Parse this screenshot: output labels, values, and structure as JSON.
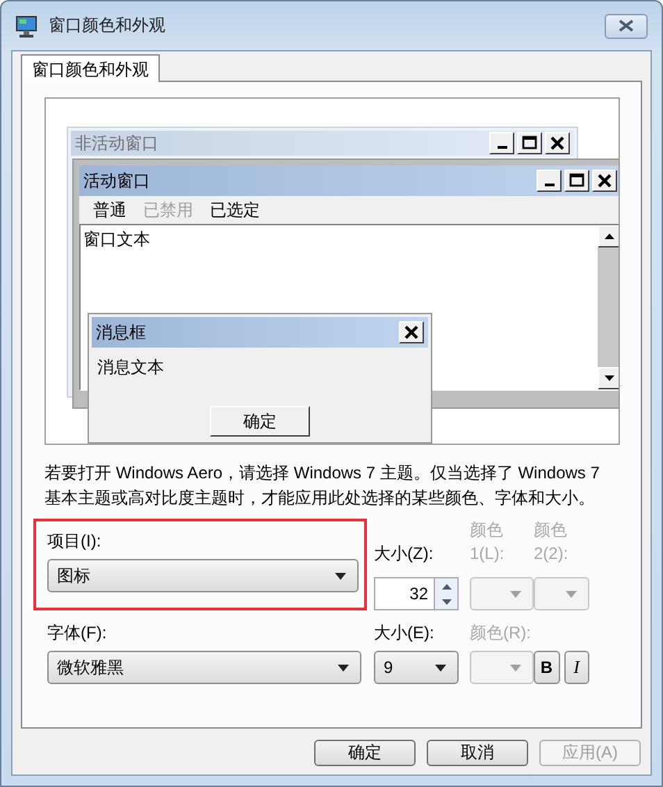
{
  "window": {
    "title": "窗口颜色和外观"
  },
  "tabs": [
    {
      "label": "窗口颜色和外观",
      "selected": true
    }
  ],
  "preview": {
    "inactive_window": {
      "title": "非活动窗口"
    },
    "active_window": {
      "title": "活动窗口",
      "menu": [
        {
          "label": "普通",
          "disabled": false
        },
        {
          "label": "已禁用",
          "disabled": true
        },
        {
          "label": "已选定",
          "disabled": false
        }
      ],
      "text": "窗口文本"
    },
    "message_box": {
      "title": "消息框",
      "text": "消息文本",
      "button": "确定"
    }
  },
  "note": "若要打开 Windows Aero，请选择 Windows 7 主题。仅当选择了 Windows 7 基本主题或高对比度主题时，才能应用此处选择的某些颜色、字体和大小。",
  "item": {
    "label": "项目(I):",
    "value": "图标",
    "highlighted": true
  },
  "item_size": {
    "label": "大小(Z):",
    "value": "32"
  },
  "color_1": {
    "label": "颜色 1(L):",
    "disabled": true
  },
  "color_2": {
    "label": "颜色 2(2):",
    "disabled": true
  },
  "font": {
    "label": "字体(F):",
    "value": "微软雅黑"
  },
  "font_size": {
    "label": "大小(E):",
    "value": "9"
  },
  "font_color": {
    "label": "颜色(R):",
    "disabled": true
  },
  "bold": {
    "label": "B"
  },
  "italic": {
    "label": "I"
  },
  "buttons": [
    {
      "label": "确定",
      "disabled": false
    },
    {
      "label": "取消",
      "disabled": false
    },
    {
      "label": "应用(A)",
      "disabled": true
    }
  ]
}
